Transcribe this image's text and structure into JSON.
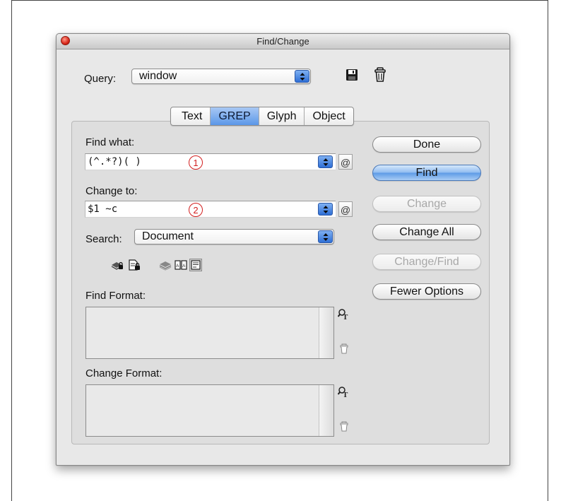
{
  "window": {
    "title": "Find/Change"
  },
  "query": {
    "label": "Query:",
    "value": "window"
  },
  "tabs": [
    {
      "label": "Text",
      "active": false
    },
    {
      "label": "GREP",
      "active": true
    },
    {
      "label": "Glyph",
      "active": false
    },
    {
      "label": "Object",
      "active": false
    }
  ],
  "find_what": {
    "label": "Find what:",
    "value": "(^.*?)( )",
    "annotation": "1"
  },
  "change_to": {
    "label": "Change to:",
    "value": "$1 ~c",
    "annotation": "2"
  },
  "special_char_icon": "@",
  "search": {
    "label": "Search:",
    "value": "Document"
  },
  "find_format": {
    "label": "Find Format:"
  },
  "change_format": {
    "label": "Change Format:"
  },
  "buttons": {
    "done": "Done",
    "find": "Find",
    "change": "Change",
    "change_all": "Change All",
    "change_find": "Change/Find",
    "fewer_options": "Fewer Options"
  },
  "colors": {
    "accent": "#5b97e8",
    "annotation": "#d21f1f",
    "close_button": "#d9271a"
  }
}
